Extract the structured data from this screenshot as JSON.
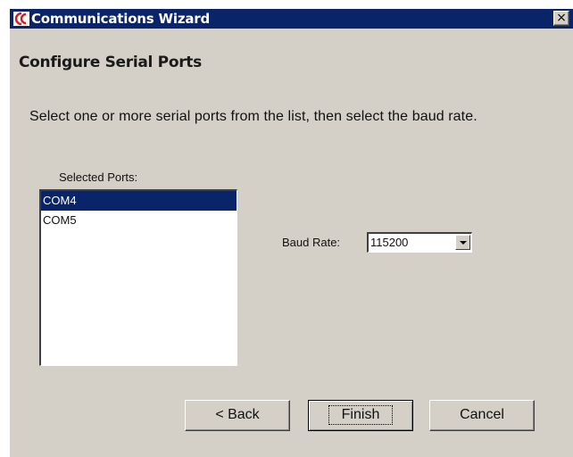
{
  "window": {
    "title": "Communications Wizard",
    "close_glyph": "×",
    "icon": "app-logo-icon",
    "title_bar_color": "#0a246a",
    "face_color": "#d4d0c8"
  },
  "page": {
    "heading": "Configure Serial Ports",
    "instruction": "Select one or more serial ports from the list, then select the baud rate."
  },
  "ports": {
    "label": "Selected Ports:",
    "items": [
      {
        "label": "COM4",
        "selected": true
      },
      {
        "label": "COM5",
        "selected": false
      }
    ],
    "selection_color": "#0a246a"
  },
  "baud": {
    "label": "Baud Rate:",
    "value": "115200",
    "dropdown_icon": "chevron-down-icon"
  },
  "buttons": {
    "back": "< Back",
    "finish": "Finish",
    "cancel": "Cancel"
  }
}
